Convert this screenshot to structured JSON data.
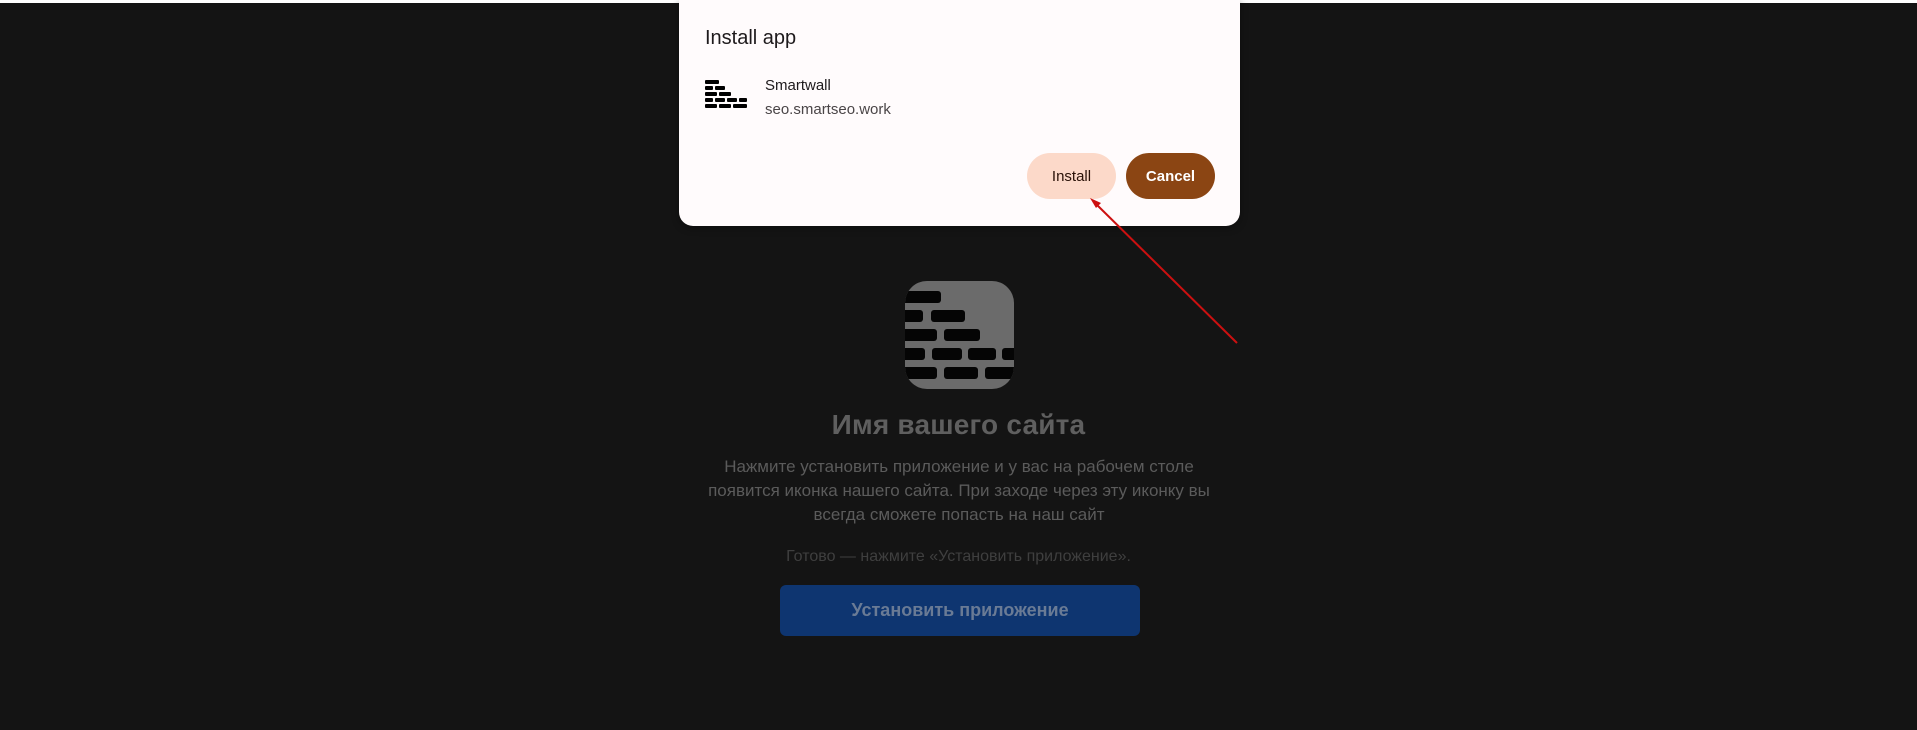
{
  "dialog": {
    "title": "Install app",
    "app_name": "Smartwall",
    "app_url": "seo.smartseo.work",
    "install_label": "Install",
    "cancel_label": "Cancel"
  },
  "page": {
    "site_title": "Имя вашего сайта",
    "description": "Нажмите установить приложение и у вас на рабочем столе появится иконка нашего сайта. При заходе через эту иконку вы всегда сможете попасть на наш сайт",
    "status": "Готово — нажмите «Установить приложение».",
    "install_button_label": "Установить приложение"
  },
  "icons": {
    "app_icon": "brick-wall-icon",
    "site_icon": "brick-wall-icon",
    "annotation": "red-arrow-annotation"
  },
  "colors": {
    "background": "#141414",
    "dialog_bg": "#fffbfc",
    "install_btn": "#fcd9c9",
    "cancel_btn": "#8b4513",
    "primary_btn": "#0e3570",
    "arrow": "#cc1010"
  }
}
